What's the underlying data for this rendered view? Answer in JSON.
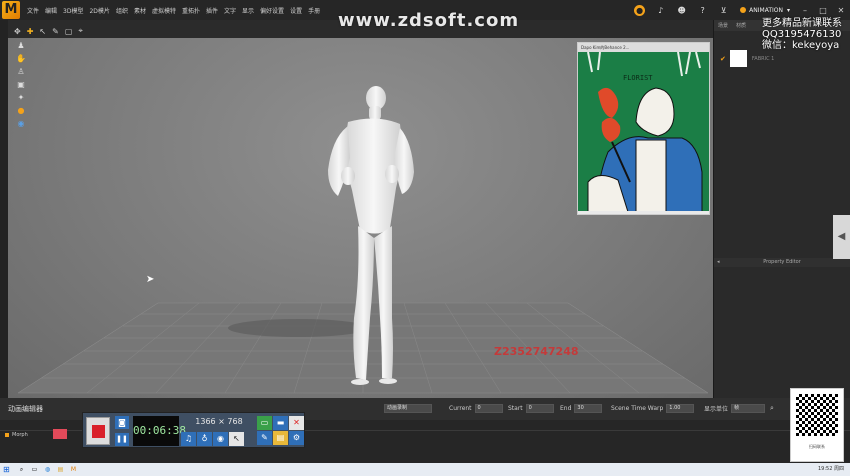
{
  "menu": {
    "items": [
      "文件",
      "编辑",
      "3D模型",
      "2D模片",
      "组织",
      "素材",
      "虚拟模特",
      "重拓扑",
      "插件",
      "文字",
      "显示",
      "偏好设置",
      "设置",
      "手册"
    ]
  },
  "top_right": {
    "anim_label": "ANIMATION"
  },
  "watermark": {
    "site": "www.zdsoft.com",
    "promo_line1": "更多精品新课联系",
    "promo_line2": "QQ3195476130",
    "promo_line3": "微信：kekeyoya",
    "id_text": "Z2352747248"
  },
  "video": {
    "title": "Dapo Kim的Behance 2...",
    "poster_text": "FLORIST"
  },
  "right_panel": {
    "tabs": [
      "场景",
      "材质"
    ],
    "item_label": "FABRIC 1",
    "property_editor": "Property Editor"
  },
  "timeline": {
    "title": "动画编辑器",
    "mode_value": "动画录制",
    "current_label": "Current",
    "current_value": "0",
    "start_label": "Start",
    "start_value": "0",
    "end_label": "End",
    "end_value": "30",
    "scene_time_warp_label": "Scene Time Warp",
    "scene_time_warp_value": "1.00",
    "display_unit_label": "显示单位",
    "display_unit_value": "帧",
    "track_label": "Morph"
  },
  "recorder": {
    "timer": "00:06:38",
    "resolution": "1366 × 768"
  },
  "qr": {
    "caption": "扫码联系"
  },
  "taskbar": {
    "clock": "19:52 周四"
  },
  "colors": {
    "accent": "#f4a21a",
    "recorder_blue": "#2f6fb8",
    "record_red": "#d9202a",
    "video_bg": "#1b7e46"
  }
}
